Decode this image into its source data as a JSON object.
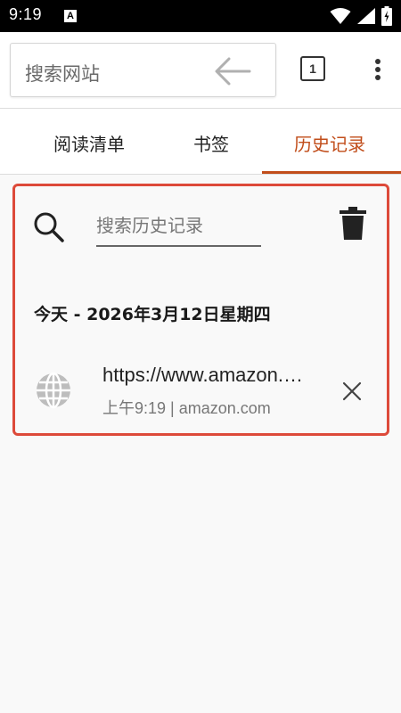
{
  "status_bar": {
    "time": "9:19",
    "notification_glyph": "A"
  },
  "toolbar": {
    "search_placeholder": "搜索网站",
    "tab_count": "1"
  },
  "tabs": [
    {
      "label": "阅读清单",
      "selected": false
    },
    {
      "label": "书签",
      "selected": false
    },
    {
      "label": "历史记录",
      "selected": true
    }
  ],
  "history": {
    "search_placeholder": "搜索历史记录",
    "date_header": "今天 - 2026年3月12日星期四",
    "entries": [
      {
        "title": "https://www.amazon.com/",
        "time": "上午9:19",
        "domain": "amazon.com"
      }
    ]
  },
  "colors": {
    "accent": "#c14d1a",
    "highlight_border": "#dd4a3a"
  }
}
